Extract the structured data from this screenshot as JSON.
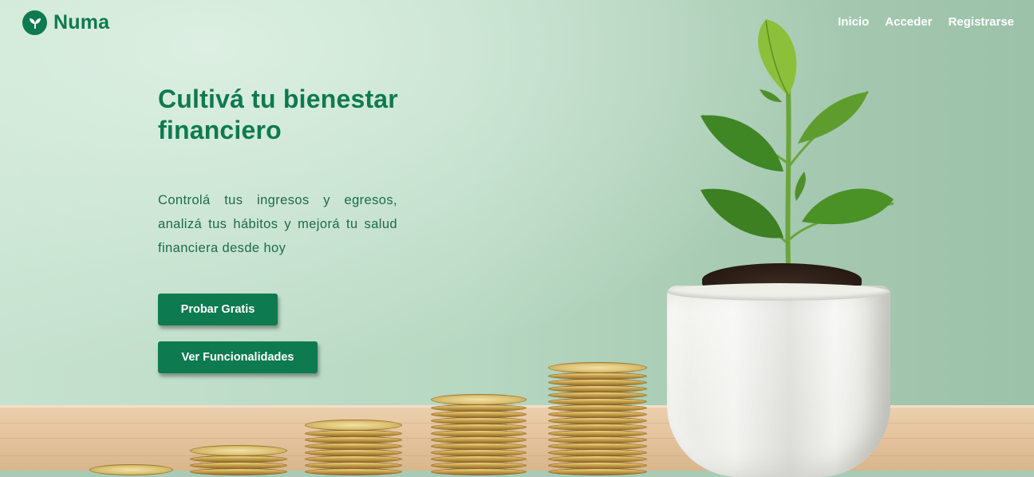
{
  "brand": {
    "name": "Numa",
    "color": "#0e7a4f"
  },
  "nav": {
    "items": [
      {
        "label": "Inicio"
      },
      {
        "label": "Acceder"
      },
      {
        "label": "Registrarse"
      }
    ]
  },
  "hero": {
    "title": "Cultivá tu bienestar financiero",
    "description": "Controlá tus ingresos y egresos, analizá tus hábitos y mejorá tu salud financiera desde hoy",
    "primary_button": "Probar Gratis",
    "secondary_button": "Ver Funcionalidades"
  },
  "icons": {
    "logo": "sprout-icon"
  },
  "colors": {
    "accent": "#0e7a4f",
    "nav_text": "#ffffff",
    "background": "#b7d8c2"
  }
}
